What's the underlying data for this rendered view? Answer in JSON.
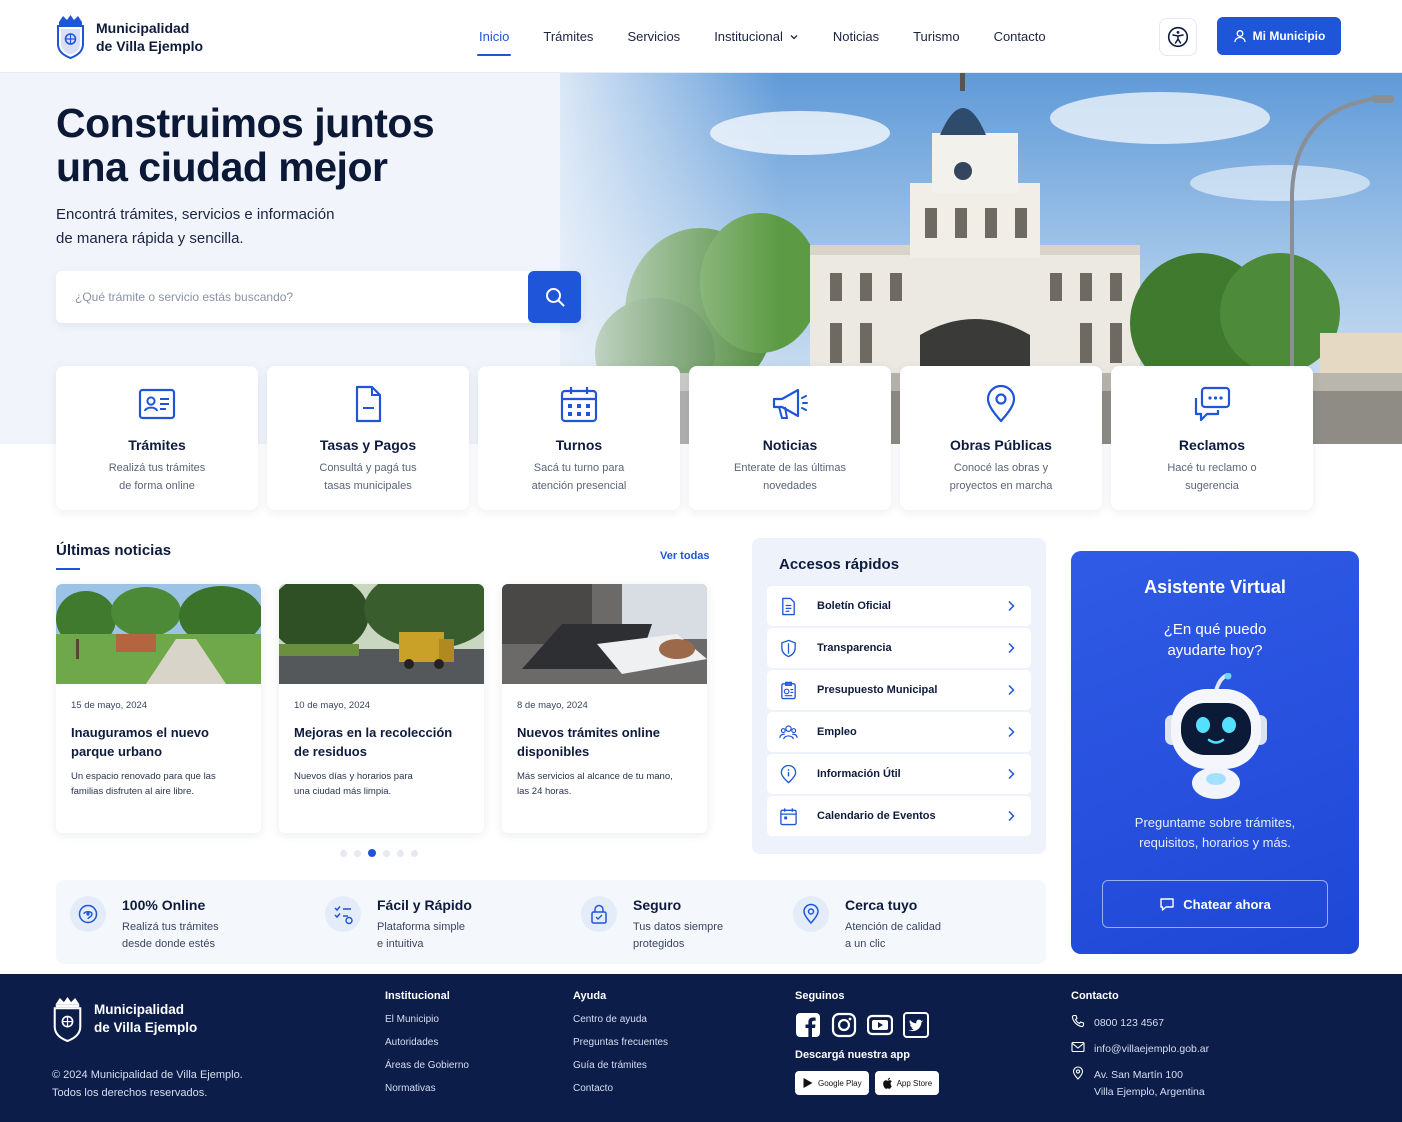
{
  "brand": {
    "line1": "Municipalidad",
    "line2": "de Villa Ejemplo"
  },
  "nav": {
    "items": [
      {
        "label": "Inicio",
        "active": true
      },
      {
        "label": "Trámites"
      },
      {
        "label": "Servicios"
      },
      {
        "label": "Institucional",
        "dropdown": true
      },
      {
        "label": "Noticias"
      },
      {
        "label": "Turismo"
      },
      {
        "label": "Contacto"
      }
    ],
    "accessibility_icon": "accessibility-icon",
    "account_button": "Mi Municipio"
  },
  "hero": {
    "title_line1": "Construimos juntos",
    "title_line2": "una ciudad mejor",
    "subtitle_line1": "Encontrá trámites, servicios e información",
    "subtitle_line2": "de manera rápida y sencilla.",
    "search_placeholder": "¿Qué trámite o servicio estás buscando?"
  },
  "services": [
    {
      "title": "Trámites",
      "desc1": "Realizá tus trámites",
      "desc2": "de forma online",
      "icon": "id-card-icon"
    },
    {
      "title": "Tasas y Pagos",
      "desc1": "Consultá y pagá tus",
      "desc2": "tasas municipales",
      "icon": "document-icon"
    },
    {
      "title": "Turnos",
      "desc1": "Sacá tu turno para",
      "desc2": "atención presencial",
      "icon": "calendar-icon"
    },
    {
      "title": "Noticias",
      "desc1": "Enterate de las últimas",
      "desc2": "novedades",
      "icon": "megaphone-icon"
    },
    {
      "title": "Obras Públicas",
      "desc1": "Conocé las obras y",
      "desc2": "proyectos en marcha",
      "icon": "map-pin-icon"
    },
    {
      "title": "Reclamos",
      "desc1": "Hacé tu reclamo o",
      "desc2": "sugerencia",
      "icon": "chat-bubbles-icon"
    }
  ],
  "news": {
    "title": "Últimas noticias",
    "see_all": "Ver todas",
    "items": [
      {
        "date": "15 de mayo, 2024",
        "title1": "Inauguramos el nuevo",
        "title2": "parque urbano",
        "desc1": "Un espacio renovado para que las",
        "desc2": "familias disfruten al aire libre."
      },
      {
        "date": "10 de mayo, 2024",
        "title1": "Mejoras en la recolección",
        "title2": "de residuos",
        "desc1": "Nuevos días y horarios para",
        "desc2": "una ciudad más limpia."
      },
      {
        "date": "8 de mayo, 2024",
        "title1": "Nuevos trámites online",
        "title2": "disponibles",
        "desc1": "Más servicios al alcance de tu mano,",
        "desc2": "las 24 horas."
      }
    ],
    "pagination": {
      "total": 6,
      "active": 3
    }
  },
  "quick_access": {
    "title": "Accesos rápidos",
    "items": [
      {
        "label": "Boletín Oficial",
        "icon": "document-icon"
      },
      {
        "label": "Transparencia",
        "icon": "shield-icon"
      },
      {
        "label": "Presupuesto Municipal",
        "icon": "budget-icon"
      },
      {
        "label": "Empleo",
        "icon": "people-icon"
      },
      {
        "label": "Información Útil",
        "icon": "info-icon"
      },
      {
        "label": "Calendario de Eventos",
        "icon": "calendar-icon"
      }
    ]
  },
  "assistant": {
    "title": "Asistente Virtual",
    "question1": "¿En qué puedo",
    "question2": "ayudarte hoy?",
    "desc1": "Preguntame sobre trámites,",
    "desc2": "requisitos, horarios y más.",
    "button": "Chatear ahora"
  },
  "features": [
    {
      "title": "100% Online",
      "desc1": "Realizá tus trámites",
      "desc2": "desde donde estés",
      "icon": "online-icon"
    },
    {
      "title": "Fácil y Rápido",
      "desc1": "Plataforma simple",
      "desc2": "e intuitiva",
      "icon": "checklist-icon"
    },
    {
      "title": "Seguro",
      "desc1": "Tus datos siempre",
      "desc2": "protegidos",
      "icon": "lock-icon"
    },
    {
      "title": "Cerca tuyo",
      "desc1": "Atención de calidad",
      "desc2": "a un clic",
      "icon": "map-pin-icon"
    }
  ],
  "footer": {
    "copyright1": "© 2024 Municipalidad de Villa Ejemplo.",
    "copyright2": "Todos los derechos reservados.",
    "institucional": {
      "title": "Institucional",
      "links": [
        "El Municipio",
        "Autoridades",
        "Áreas de Gobierno",
        "Normativas"
      ]
    },
    "ayuda": {
      "title": "Ayuda",
      "links": [
        "Centro de ayuda",
        "Preguntas frecuentes",
        "Guía de trámites",
        "Contacto"
      ]
    },
    "social": {
      "title": "Seguinos",
      "icons": [
        "facebook-icon",
        "instagram-icon",
        "youtube-icon",
        "twitter-icon"
      ]
    },
    "app": {
      "title": "Descargá nuestra app",
      "google": "Google Play",
      "apple": "App Store"
    },
    "contact": {
      "title": "Contacto",
      "phone": "0800 123 4567",
      "email": "info@villaejemplo.gob.ar",
      "address1": "Av. San Martín 100",
      "address2": "Villa Ejemplo, Argentina"
    }
  },
  "colors": {
    "primary": "#1f55d8",
    "navy": "#0c1d4a",
    "text": "#0e1b3d"
  }
}
